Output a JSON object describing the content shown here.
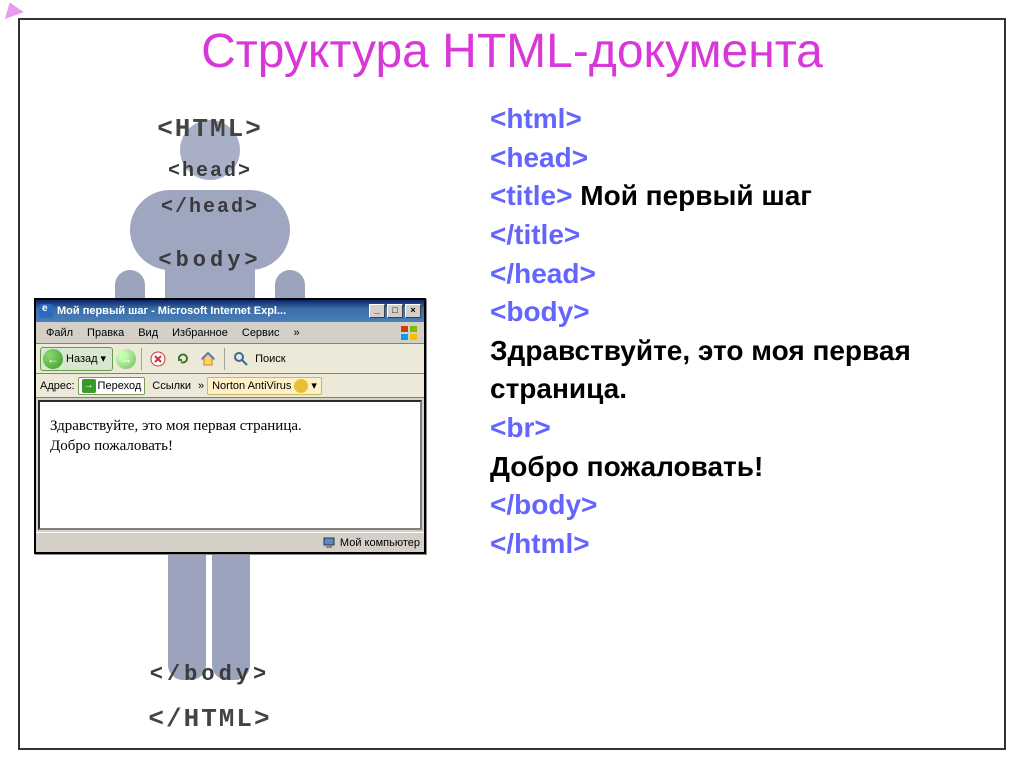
{
  "slide": {
    "title": "Структура HTML-документа"
  },
  "figure_tags": {
    "html_open": "<HTML>",
    "head_open": "<head>",
    "head_close": "</head>",
    "body_open": "<body>",
    "body_close": "</body>",
    "html_close": "</HTML>"
  },
  "ie": {
    "title": "Мой первый шаг - Microsoft Internet Expl...",
    "menu": {
      "file": "Файл",
      "edit": "Правка",
      "view": "Вид",
      "favorites": "Избранное",
      "tools": "Сервис",
      "more": "»"
    },
    "toolbar": {
      "back": "Назад",
      "search": "Поиск"
    },
    "address": {
      "label": "Адрес:",
      "go": "Переход",
      "links": "Ссылки",
      "more": "»",
      "norton": "Norton AntiVirus"
    },
    "content": {
      "line1": "Здравствуйте, это моя первая страница.",
      "line2": "Добро пожаловать!"
    },
    "status": "Мой компьютер"
  },
  "code": {
    "l1": "<html>",
    "l2": "<head>",
    "l3a": "<title>",
    "l3b": " Мой первый шаг ",
    "l4": "</title>",
    "l5": "</head>",
    "l6": "<body>",
    "l7": "Здравствуйте, это моя первая страница.",
    "l8": "<br>",
    "l9": "Добро пожаловать!",
    "l10": "</body>",
    "l11": "</html>"
  }
}
